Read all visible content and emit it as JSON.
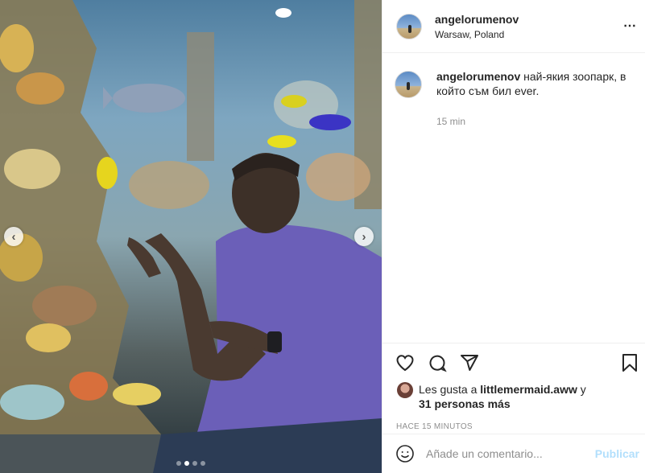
{
  "post": {
    "username": "angelorumenov",
    "location": "Warsaw, Poland",
    "more_icon": "⋯"
  },
  "carousel": {
    "prev_icon": "‹",
    "next_icon": "›",
    "current_index": 2,
    "total": 4
  },
  "caption": {
    "username": "angelorumenov",
    "text": "най-якия зоопарк, в който съм бил ever.",
    "time": "15 min"
  },
  "actions": {
    "icons": [
      "heart-icon",
      "comment-icon",
      "share-icon",
      "bookmark-icon"
    ]
  },
  "likes": {
    "prefix": "Les gusta a ",
    "liker": "littlemermaid.aww",
    "connector": " y",
    "others": "31 personas más"
  },
  "timestamp": "HACE 15 MINUTOS",
  "comment_box": {
    "placeholder": "Añade un comentario...",
    "publish_label": "Publicar",
    "emoji_icon": "emoji-icon"
  },
  "colors": {
    "publish_disabled": "#b2dffc",
    "secondary_text": "#8e8e8e",
    "border": "#efefef"
  }
}
